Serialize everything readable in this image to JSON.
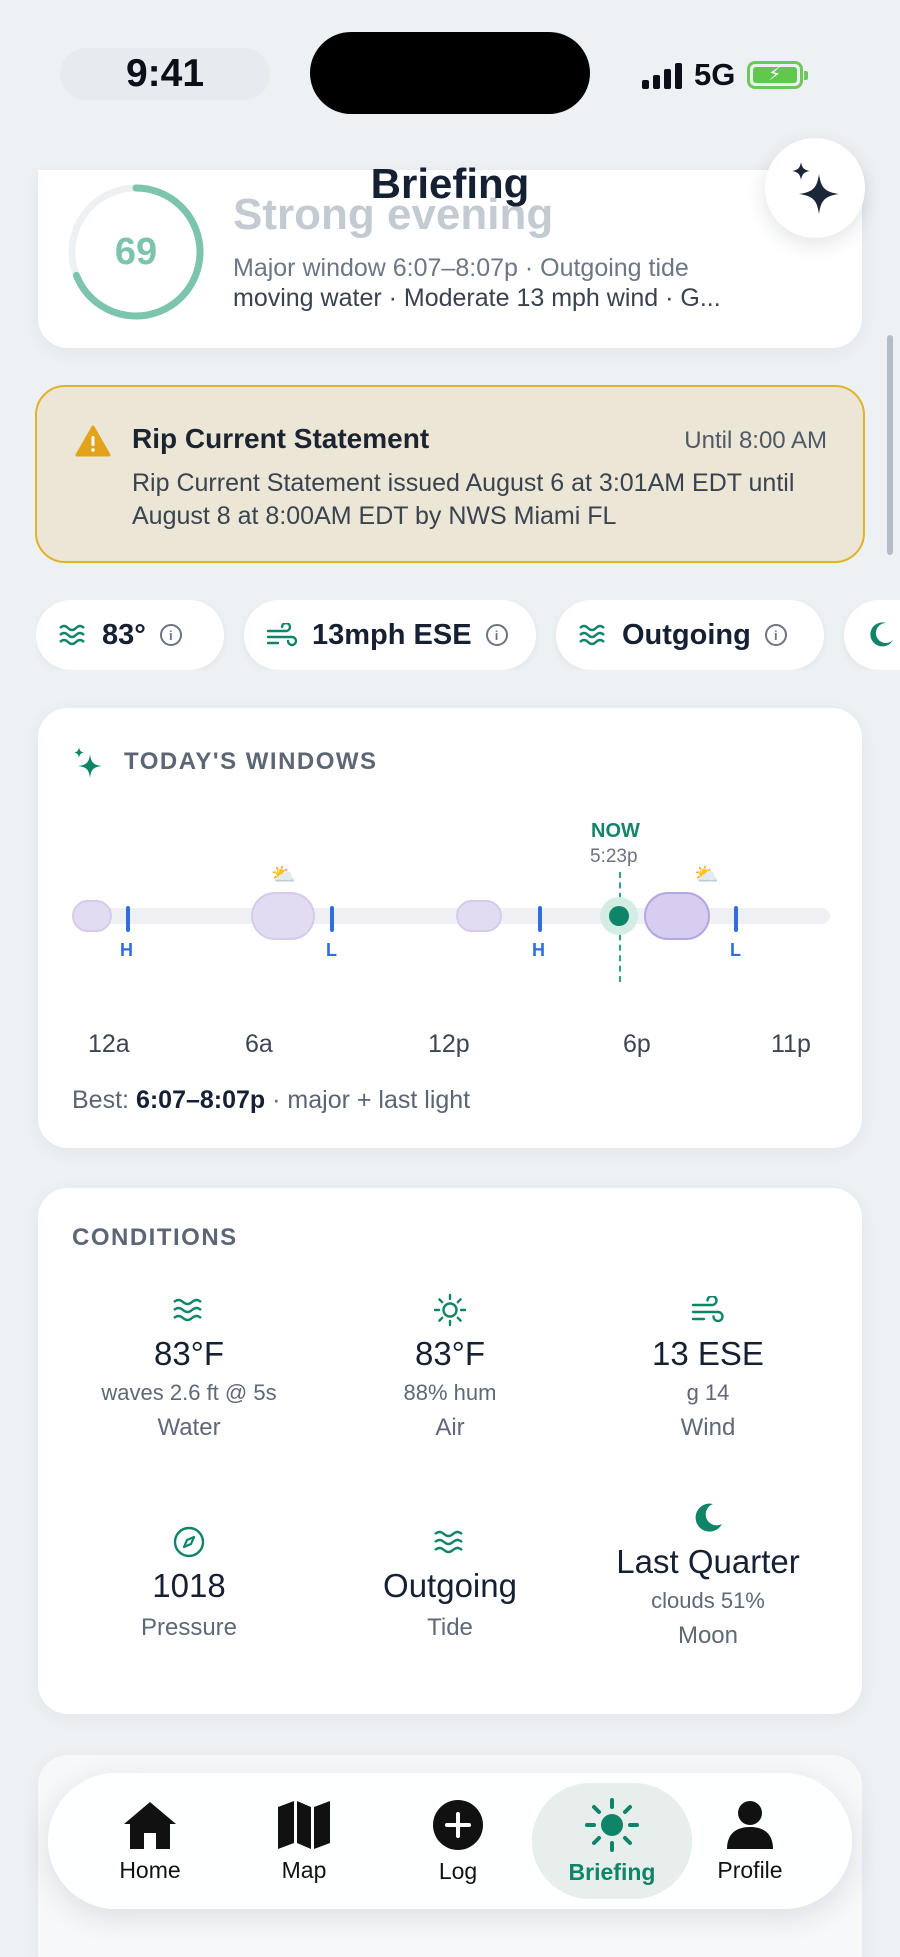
{
  "status_bar": {
    "time": "9:41",
    "network": "5G"
  },
  "header": {
    "title": "Briefing"
  },
  "score_card": {
    "score": "69",
    "score_fraction": 0.69,
    "title": "Strong evening",
    "line1": "Major window 6:07–8:07p · Outgoing tide",
    "line2": "moving water · Moderate 13 mph wind · G..."
  },
  "alert": {
    "title": "Rip Current Statement",
    "until": "Until 8:00 AM",
    "body": "Rip Current Statement issued August 6 at 3:01AM EDT until August 8 at 8:00AM EDT by NWS Miami FL",
    "colors": {
      "border": "#e2b229",
      "background": "#ebe6d6",
      "icon": "#e2a21a"
    }
  },
  "chips": [
    {
      "icon": "waves-icon",
      "label": "83°"
    },
    {
      "icon": "wind-icon",
      "label": "13mph ESE"
    },
    {
      "icon": "waves-icon",
      "label": "Outgoing"
    },
    {
      "icon": "moon-icon",
      "label": ""
    }
  ],
  "windows": {
    "title": "TODAY'S WINDOWS",
    "now_label": "NOW",
    "now_time": "5:23p",
    "tide_marks": [
      "H",
      "L",
      "H",
      "L"
    ],
    "axis_labels": [
      "12a",
      "6a",
      "12p",
      "6p",
      "11p"
    ],
    "best_prefix": "Best:",
    "best_time": "6:07–8:07p",
    "best_suffix": "· major + last light"
  },
  "conditions": {
    "title": "CONDITIONS",
    "water": {
      "value": "83°F",
      "sub": "waves 2.6 ft @ 5s",
      "label": "Water"
    },
    "air": {
      "value": "83°F",
      "sub": "88% hum",
      "label": "Air"
    },
    "wind": {
      "value": "13 ESE",
      "sub": "g 14",
      "label": "Wind"
    },
    "pressure": {
      "value": "1018",
      "label": "Pressure"
    },
    "tide": {
      "value": "Outgoing",
      "label": "Tide"
    },
    "moon": {
      "value": "Last Quarter",
      "sub": "clouds 51%",
      "label": "Moon"
    }
  },
  "tabbar": {
    "tabs": [
      {
        "label": "Home",
        "icon": "home-icon"
      },
      {
        "label": "Map",
        "icon": "map-icon"
      },
      {
        "label": "Log",
        "icon": "plus-circle-icon"
      },
      {
        "label": "Briefing",
        "icon": "sun-icon",
        "active": true
      },
      {
        "label": "Profile",
        "icon": "person-icon"
      }
    ]
  },
  "colors": {
    "accent": "#0e8468",
    "tide_marker": "#2f6de0",
    "window_pill": "#e2dcf2"
  }
}
